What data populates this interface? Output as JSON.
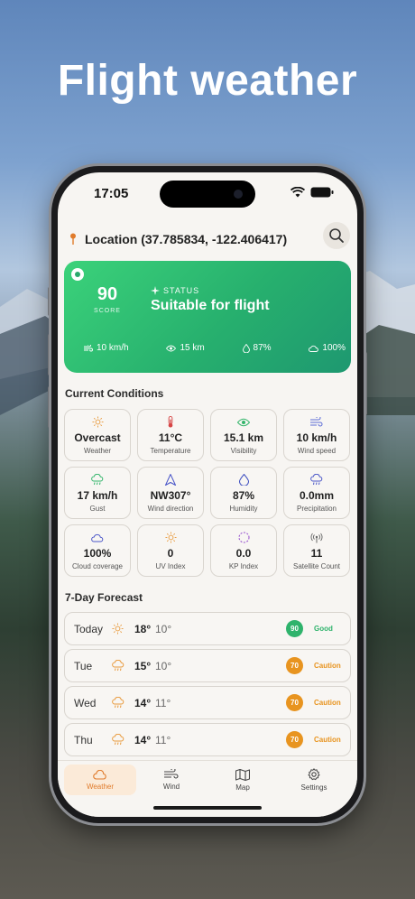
{
  "promo_title": "Flight weather",
  "status_bar": {
    "time": "17:05"
  },
  "location": {
    "label": "Location (37.785834, -122.406417)"
  },
  "score_card": {
    "score": "90",
    "score_label": "SCORE",
    "status_label": "STATUS",
    "status_value": "Suitable for flight",
    "metrics": [
      {
        "icon": "wind-icon",
        "value": "10 km/h"
      },
      {
        "icon": "eye-icon",
        "value": "15 km"
      },
      {
        "icon": "droplet-icon",
        "value": "87%"
      },
      {
        "icon": "cloud-icon",
        "value": "100%"
      }
    ]
  },
  "current_conditions": {
    "title": "Current Conditions",
    "tiles": [
      {
        "value": "Overcast",
        "label": "Weather",
        "icon": "sun-icon",
        "color": "#e89a3c"
      },
      {
        "value": "11°C",
        "label": "Temperature",
        "icon": "thermometer-icon",
        "color": "#d64545"
      },
      {
        "value": "15.1 km",
        "label": "Visibility",
        "icon": "eye-icon",
        "color": "#33b56b"
      },
      {
        "value": "10 km/h",
        "label": "Wind speed",
        "icon": "wind-icon",
        "color": "#5b6cd6"
      },
      {
        "value": "17 km/h",
        "label": "Gust",
        "icon": "gust-cloud-icon",
        "color": "#33b56b"
      },
      {
        "value": "NW307°",
        "label": "Wind direction",
        "icon": "navigation-arrow-icon",
        "color": "#4a56c8"
      },
      {
        "value": "87%",
        "label": "Humidity",
        "icon": "droplet-icon",
        "color": "#3e4fc0"
      },
      {
        "value": "0.0mm",
        "label": "Precipitation",
        "icon": "rain-cloud-icon",
        "color": "#4a56c8"
      },
      {
        "value": "100%",
        "label": "Cloud coverage",
        "icon": "cloud-icon",
        "color": "#4a56c8"
      },
      {
        "value": "0",
        "label": "UV Index",
        "icon": "sun-icon",
        "color": "#e89a3c"
      },
      {
        "value": "0.0",
        "label": "KP Index",
        "icon": "dashed-circle-icon",
        "color": "#9b59d0"
      },
      {
        "value": "11",
        "label": "Satellite Count",
        "icon": "antenna-icon",
        "color": "#666666"
      }
    ]
  },
  "forecast": {
    "title": "7-Day Forecast",
    "days": [
      {
        "day": "Today",
        "icon": "sun-icon",
        "high": "18°",
        "low": "10°",
        "score": "90",
        "rating": "Good",
        "color": "#2fb36c"
      },
      {
        "day": "Tue",
        "icon": "rain-cloud-icon",
        "high": "15°",
        "low": "10°",
        "score": "70",
        "rating": "Caution",
        "color": "#e8941f"
      },
      {
        "day": "Wed",
        "icon": "rain-cloud-icon",
        "high": "14°",
        "low": "11°",
        "score": "70",
        "rating": "Caution",
        "color": "#e8941f"
      },
      {
        "day": "Thu",
        "icon": "rain-cloud-icon",
        "high": "14°",
        "low": "11°",
        "score": "70",
        "rating": "Caution",
        "color": "#e8941f"
      }
    ]
  },
  "tabs": [
    {
      "label": "Weather",
      "icon": "cloud-icon",
      "active": true
    },
    {
      "label": "Wind",
      "icon": "wind-icon",
      "active": false
    },
    {
      "label": "Map",
      "icon": "map-icon",
      "active": false
    },
    {
      "label": "Settings",
      "icon": "gear-icon",
      "active": false
    }
  ],
  "colors": {
    "accent": "#e07b2b",
    "good": "#2fb36c",
    "caution": "#e8941f"
  }
}
